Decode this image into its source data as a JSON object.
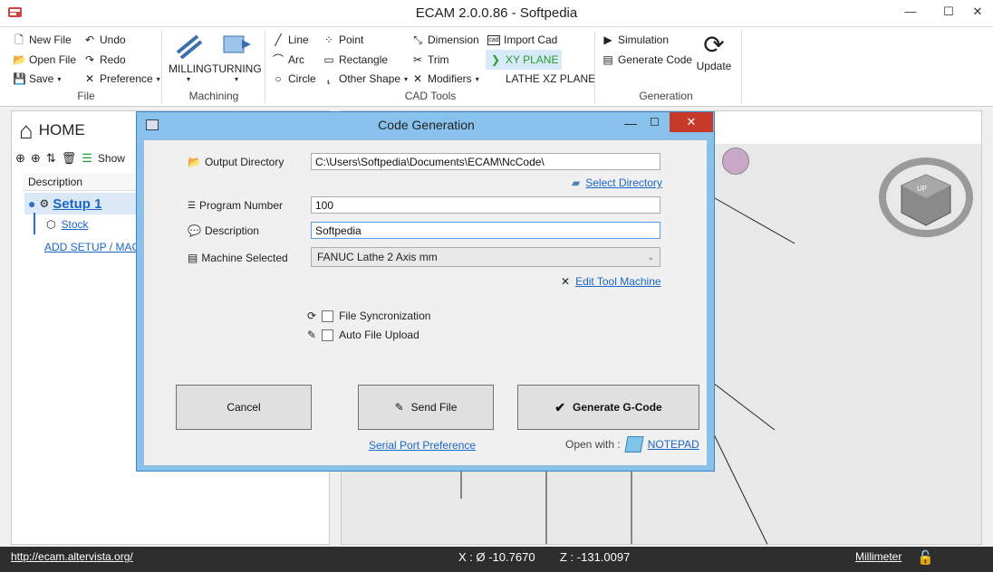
{
  "window": {
    "title": "ECAM 2.0.0.86 - Softpedia",
    "minimize": "—",
    "maximize": "☐",
    "close": "✕"
  },
  "ribbon": {
    "file": {
      "group_label": "File",
      "new_file": "New File",
      "open_file": "Open File",
      "save": "Save",
      "undo": "Undo",
      "redo": "Redo",
      "preference": "Preference"
    },
    "machining": {
      "group_label": "Machining",
      "milling": "MILLING",
      "turning": "TURNING"
    },
    "cad_tools": {
      "group_label": "CAD Tools",
      "line": "Line",
      "arc": "Arc",
      "circle": "Circle",
      "point": "Point",
      "rectangle": "Rectangle",
      "other_shape": "Other Shape",
      "dimension": "Dimension",
      "trim": "Trim",
      "modifiers": "Modifiers",
      "import_cad": "Import Cad",
      "xy_plane": "XY PLANE",
      "lathe_xz_plane": "LATHE XZ PLANE"
    },
    "generation": {
      "group_label": "Generation",
      "simulation": "Simulation",
      "generate_code": "Generate Code",
      "update": "Update"
    }
  },
  "left_panel": {
    "home": "HOME",
    "show": "Show",
    "column_description": "Description",
    "setup": "Setup 1",
    "stock": "Stock",
    "add_setup": "ADD SETUP / MAC"
  },
  "dialog": {
    "title": "Code Generation",
    "output_directory_label": "Output Directory",
    "output_directory_value": "C:\\Users\\Softpedia\\Documents\\ECAM\\NcCode\\",
    "select_directory": "Select Directory",
    "program_number_label": "Program Number",
    "program_number_value": "100",
    "description_label": "Description",
    "description_value": "Softpedia",
    "machine_selected_label": "Machine Selected",
    "machine_selected_value": "FANUC Lathe 2 Axis mm",
    "edit_tool_machine": "Edit Tool Machine",
    "file_sync": "File Syncronization",
    "auto_upload": "Auto File Upload",
    "cancel": "Cancel",
    "send_file": "Send File",
    "generate_gcode": "Generate G-Code",
    "serial_port_preference": "Serial Port Preference",
    "open_with": "Open with :",
    "notepad": "NOTEPAD"
  },
  "viewcube": {
    "top": "UP"
  },
  "status": {
    "url": "http://ecam.altervista.org/",
    "x_coord": "X : Ø -10.7670",
    "z_coord": "Z : -131.0097",
    "units": "Millimeter"
  },
  "colors": {
    "accent": "#1b66c9",
    "dialog_frame": "#88c2ec",
    "status_bg": "#2d2d2d",
    "lock_green": "#2fb52f"
  }
}
